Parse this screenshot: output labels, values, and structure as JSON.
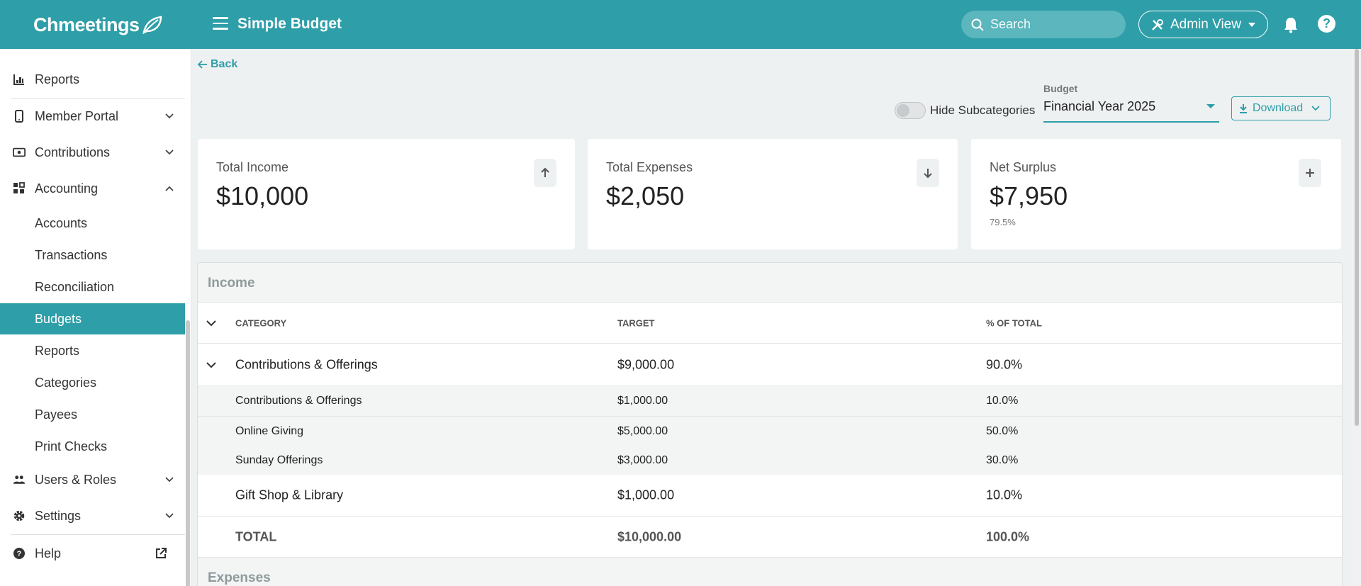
{
  "brand": {
    "name": "Chmeetings",
    "accent": "#2e9ea8"
  },
  "header": {
    "app_title": "Simple Budget",
    "search_placeholder": "Search",
    "admin_view_label": "Admin View"
  },
  "sidebar": {
    "items": [
      {
        "label": "Reports",
        "icon": "bar-chart-icon"
      },
      {
        "label": "Member Portal",
        "icon": "phone-icon",
        "expandable": true
      },
      {
        "label": "Contributions",
        "icon": "cash-icon",
        "expandable": true
      },
      {
        "label": "Accounting",
        "icon": "grid-icon",
        "expandable": true,
        "expanded": true
      },
      {
        "label": "Users & Roles",
        "icon": "users-icon",
        "expandable": true
      },
      {
        "label": "Settings",
        "icon": "gear-icon",
        "expandable": true
      },
      {
        "label": "Help",
        "icon": "help-icon"
      }
    ],
    "accounting_sub": [
      "Accounts",
      "Transactions",
      "Reconciliation",
      "Budgets",
      "Reports",
      "Categories",
      "Payees",
      "Print Checks"
    ],
    "active_sub": "Budgets"
  },
  "toolbar": {
    "back_label": "Back",
    "hide_subcategories_label": "Hide Subcategories",
    "hide_subcategories_on": false,
    "budget_label": "Budget",
    "budget_value": "Financial Year 2025",
    "download_label": "Download"
  },
  "cards": {
    "income": {
      "title": "Total Income",
      "amount": "$10,000",
      "icon": "arrow-up-icon"
    },
    "expenses": {
      "title": "Total Expenses",
      "amount": "$2,050",
      "icon": "arrow-down-icon"
    },
    "surplus": {
      "title": "Net Surplus",
      "amount": "$7,950",
      "pct": "79.5%",
      "icon": "plus-icon"
    }
  },
  "income": {
    "section_title": "Income",
    "columns": [
      "CATEGORY",
      "TARGET",
      "% OF TOTAL"
    ],
    "rows": [
      {
        "category": "Contributions & Offerings",
        "target": "$9,000.00",
        "pct": "90.0%"
      },
      {
        "category": "Contributions & Offerings",
        "target": "$1,000.00",
        "pct": "10.0%"
      },
      {
        "category": "Online Giving",
        "target": "$5,000.00",
        "pct": "50.0%"
      },
      {
        "category": "Sunday Offerings",
        "target": "$3,000.00",
        "pct": "30.0%"
      },
      {
        "category": "Gift Shop & Library",
        "target": "$1,000.00",
        "pct": "10.0%"
      }
    ],
    "total": {
      "label": "TOTAL",
      "target": "$10,000.00",
      "pct": "100.0%"
    }
  },
  "expenses": {
    "section_title": "Expenses"
  }
}
